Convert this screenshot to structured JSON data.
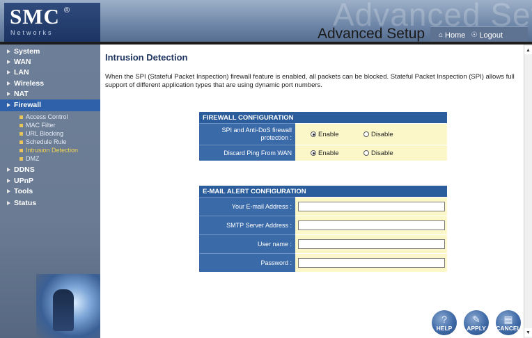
{
  "header": {
    "logo_text": "SMC",
    "logo_reg": "®",
    "logo_sub": "Networks",
    "watermark": "Advanced Setup",
    "title": "Advanced Setup",
    "home_label": "Home",
    "logout_label": "Logout",
    "home_icon": "home-icon",
    "logout_icon": "logout-icon"
  },
  "sidebar": {
    "items": [
      {
        "label": "System"
      },
      {
        "label": "WAN"
      },
      {
        "label": "LAN"
      },
      {
        "label": "Wireless"
      },
      {
        "label": "NAT"
      },
      {
        "label": "Firewall"
      },
      {
        "label": "DDNS"
      },
      {
        "label": "UPnP"
      },
      {
        "label": "Tools"
      },
      {
        "label": "Status"
      }
    ],
    "firewall_sub": [
      {
        "label": "Access Control"
      },
      {
        "label": "MAC Filter"
      },
      {
        "label": "URL Blocking"
      },
      {
        "label": "Schedule Rule"
      },
      {
        "label": "Intrusion Detection"
      },
      {
        "label": "DMZ"
      }
    ],
    "active_item": "Firewall",
    "active_sub": "Intrusion Detection"
  },
  "main": {
    "title": "Intrusion Detection",
    "intro": "When the SPI (Stateful Packet Inspection) firewall feature is enabled, all packets can be blocked.  Stateful Packet Inspection (SPI) allows full support of different application types that are using dynamic port numbers.",
    "firewall_config": {
      "heading": "FIREWALL CONFIGURATION",
      "rows": [
        {
          "label": "SPI and Anti-DoS firewall protection :",
          "enable": "Enable",
          "disable": "Disable",
          "selected": "Enable"
        },
        {
          "label": "Discard Ping From WAN",
          "enable": "Enable",
          "disable": "Disable",
          "selected": "Enable"
        }
      ]
    },
    "email_config": {
      "heading": "E-MAIL ALERT CONFIGURATION",
      "fields": [
        {
          "label": "Your E-mail Address :",
          "value": ""
        },
        {
          "label": "SMTP Server Address :",
          "value": ""
        },
        {
          "label": "User name :",
          "value": ""
        },
        {
          "label": "Password :",
          "value": ""
        }
      ]
    }
  },
  "buttons": {
    "help": "HELP",
    "apply": "APPLY",
    "cancel": "CANCEL"
  },
  "colors": {
    "header_bg": "#6f87a8",
    "sidebar_bg": "#6a7b93",
    "active_nav": "#2e61a9",
    "table_header": "#2b5d9c",
    "table_label": "#3a6aa8",
    "value_cell": "#fbf7c8",
    "active_sub_text": "#f0d450"
  }
}
